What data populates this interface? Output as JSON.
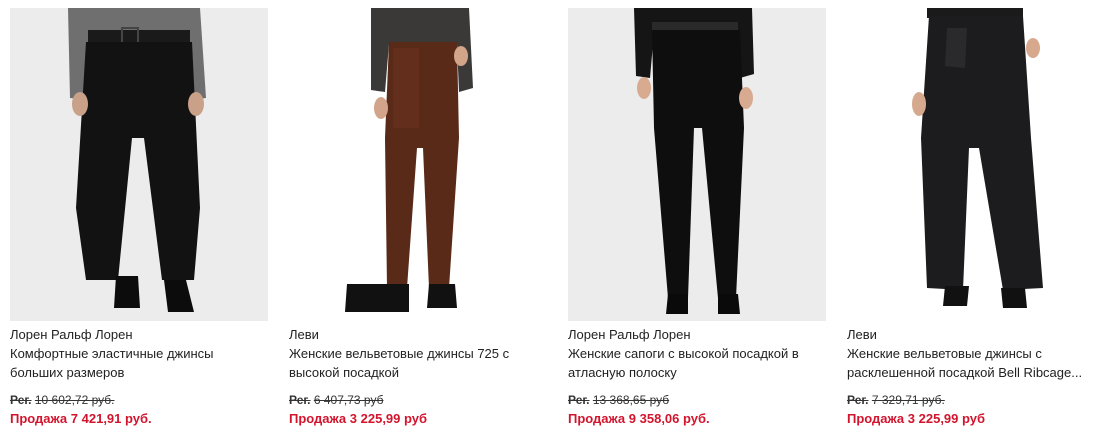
{
  "products": [
    {
      "brand": "Лорен Ральф Лорен",
      "title": "Комфортные эластичные джинсы больших размеров",
      "reg_label": "Рег.",
      "reg_price": "10 602,72 руб.",
      "sale_label": "Продажа",
      "sale_price": "7 421,91 руб.",
      "image": "black-plus-size-jeans-photo"
    },
    {
      "brand": "Леви",
      "title": "Женские вельветовые джинсы 725 с высокой посадкой",
      "reg_label": "Рег.",
      "reg_price": "6 407,73 руб",
      "sale_label": "Продажа",
      "sale_price": "3 225,99 руб",
      "image": "brown-corduroy-jeans-photo"
    },
    {
      "brand": "Лорен Ральф Лорен",
      "title": "Женские сапоги с высокой посадкой в атласную полоску",
      "reg_label": "Рег.",
      "reg_price": "13 368,65 руб",
      "sale_label": "Продажа",
      "sale_price": "9 358,06 руб.",
      "image": "black-bootcut-jeans-photo"
    },
    {
      "brand": "Леви",
      "title": "Женские вельветовые джинсы с расклешенной посадкой Bell Ribcage...",
      "reg_label": "Рег.",
      "reg_price": "7 329,71 руб.",
      "sale_label": "Продажа",
      "sale_price": "3 225,99 руб",
      "image": "black-flare-corduroy-jeans-photo"
    }
  ],
  "colors": {
    "sale": "#d2142d",
    "image_bg": "#ececec"
  }
}
